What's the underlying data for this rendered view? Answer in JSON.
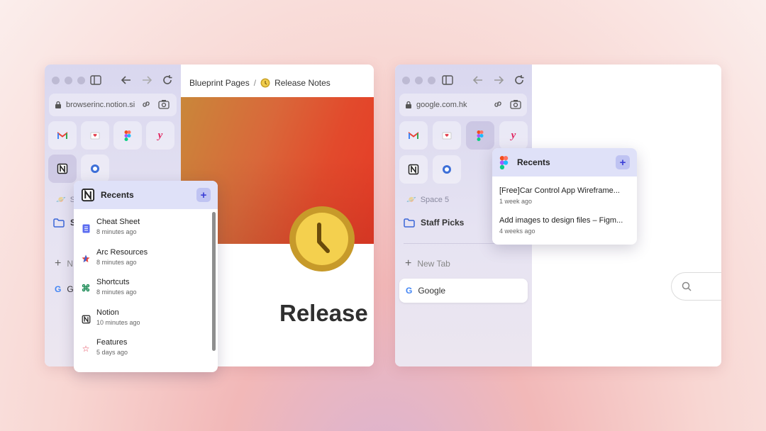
{
  "window1": {
    "url": "browserinc.notion.si",
    "space_label": "S",
    "folder_label": "S",
    "new_tab_label": "N",
    "google_label": "G",
    "breadcrumb": {
      "parent": "Blueprint Pages",
      "separator": "/",
      "current": "Release Notes"
    },
    "page_title": "Release",
    "recents": {
      "title": "Recents",
      "add_label": "+",
      "items": [
        {
          "title": "Cheat Sheet",
          "time": "8 minutes ago",
          "icon": "document-icon"
        },
        {
          "title": "Arc Resources",
          "time": "8 minutes ago",
          "icon": "arc-star-icon"
        },
        {
          "title": "Shortcuts",
          "time": "8 minutes ago",
          "icon": "command-icon"
        },
        {
          "title": "Notion",
          "time": "10 minutes ago",
          "icon": "notion-icon"
        },
        {
          "title": "Features",
          "time": "5 days ago",
          "icon": "star-outline-icon"
        }
      ]
    }
  },
  "window2": {
    "url": "google.com.hk",
    "space_label": "Space 5",
    "folder_label": "Staff Picks",
    "new_tab_label": "New Tab",
    "google_label": "Google",
    "recents": {
      "title": "Recents",
      "add_label": "+",
      "items": [
        {
          "title": "[Free]Car Control App Wireframe...",
          "time": "1 week ago"
        },
        {
          "title": "Add images to design files – Figm...",
          "time": "4 weeks ago"
        }
      ]
    }
  },
  "colors": {
    "accent": "#3b3fd6",
    "popup_header": "#dfe1f8",
    "sidebar": "#dcdaf0"
  }
}
